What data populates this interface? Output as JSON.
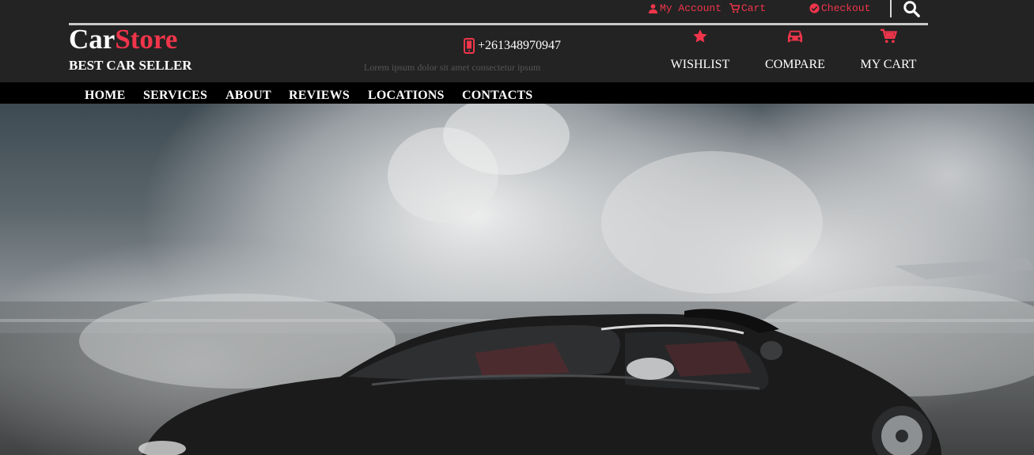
{
  "topbar": {
    "my_account": "My Account",
    "cart": "Cart",
    "checkout": "Checkout"
  },
  "brand": {
    "logo_part1": "Car",
    "logo_part2": "Store",
    "tagline": "BEST CAR SELLER"
  },
  "contact": {
    "phone": "+261348970947",
    "subtext": "Lorem ipsum dolor sit amet consectetur ipsum"
  },
  "actions": [
    {
      "label": "WISHLIST",
      "icon": "star-icon"
    },
    {
      "label": "COMPARE",
      "icon": "car-icon"
    },
    {
      "label": "MY CART",
      "icon": "cart-icon"
    }
  ],
  "nav": {
    "items": [
      "HOME",
      "SERVICES",
      "ABOUT",
      "REVIEWS",
      "LOCATIONS",
      "CONTACTS"
    ]
  },
  "colors": {
    "accent": "#f0354b",
    "header_bg": "#232323",
    "nav_bg": "#000000"
  }
}
